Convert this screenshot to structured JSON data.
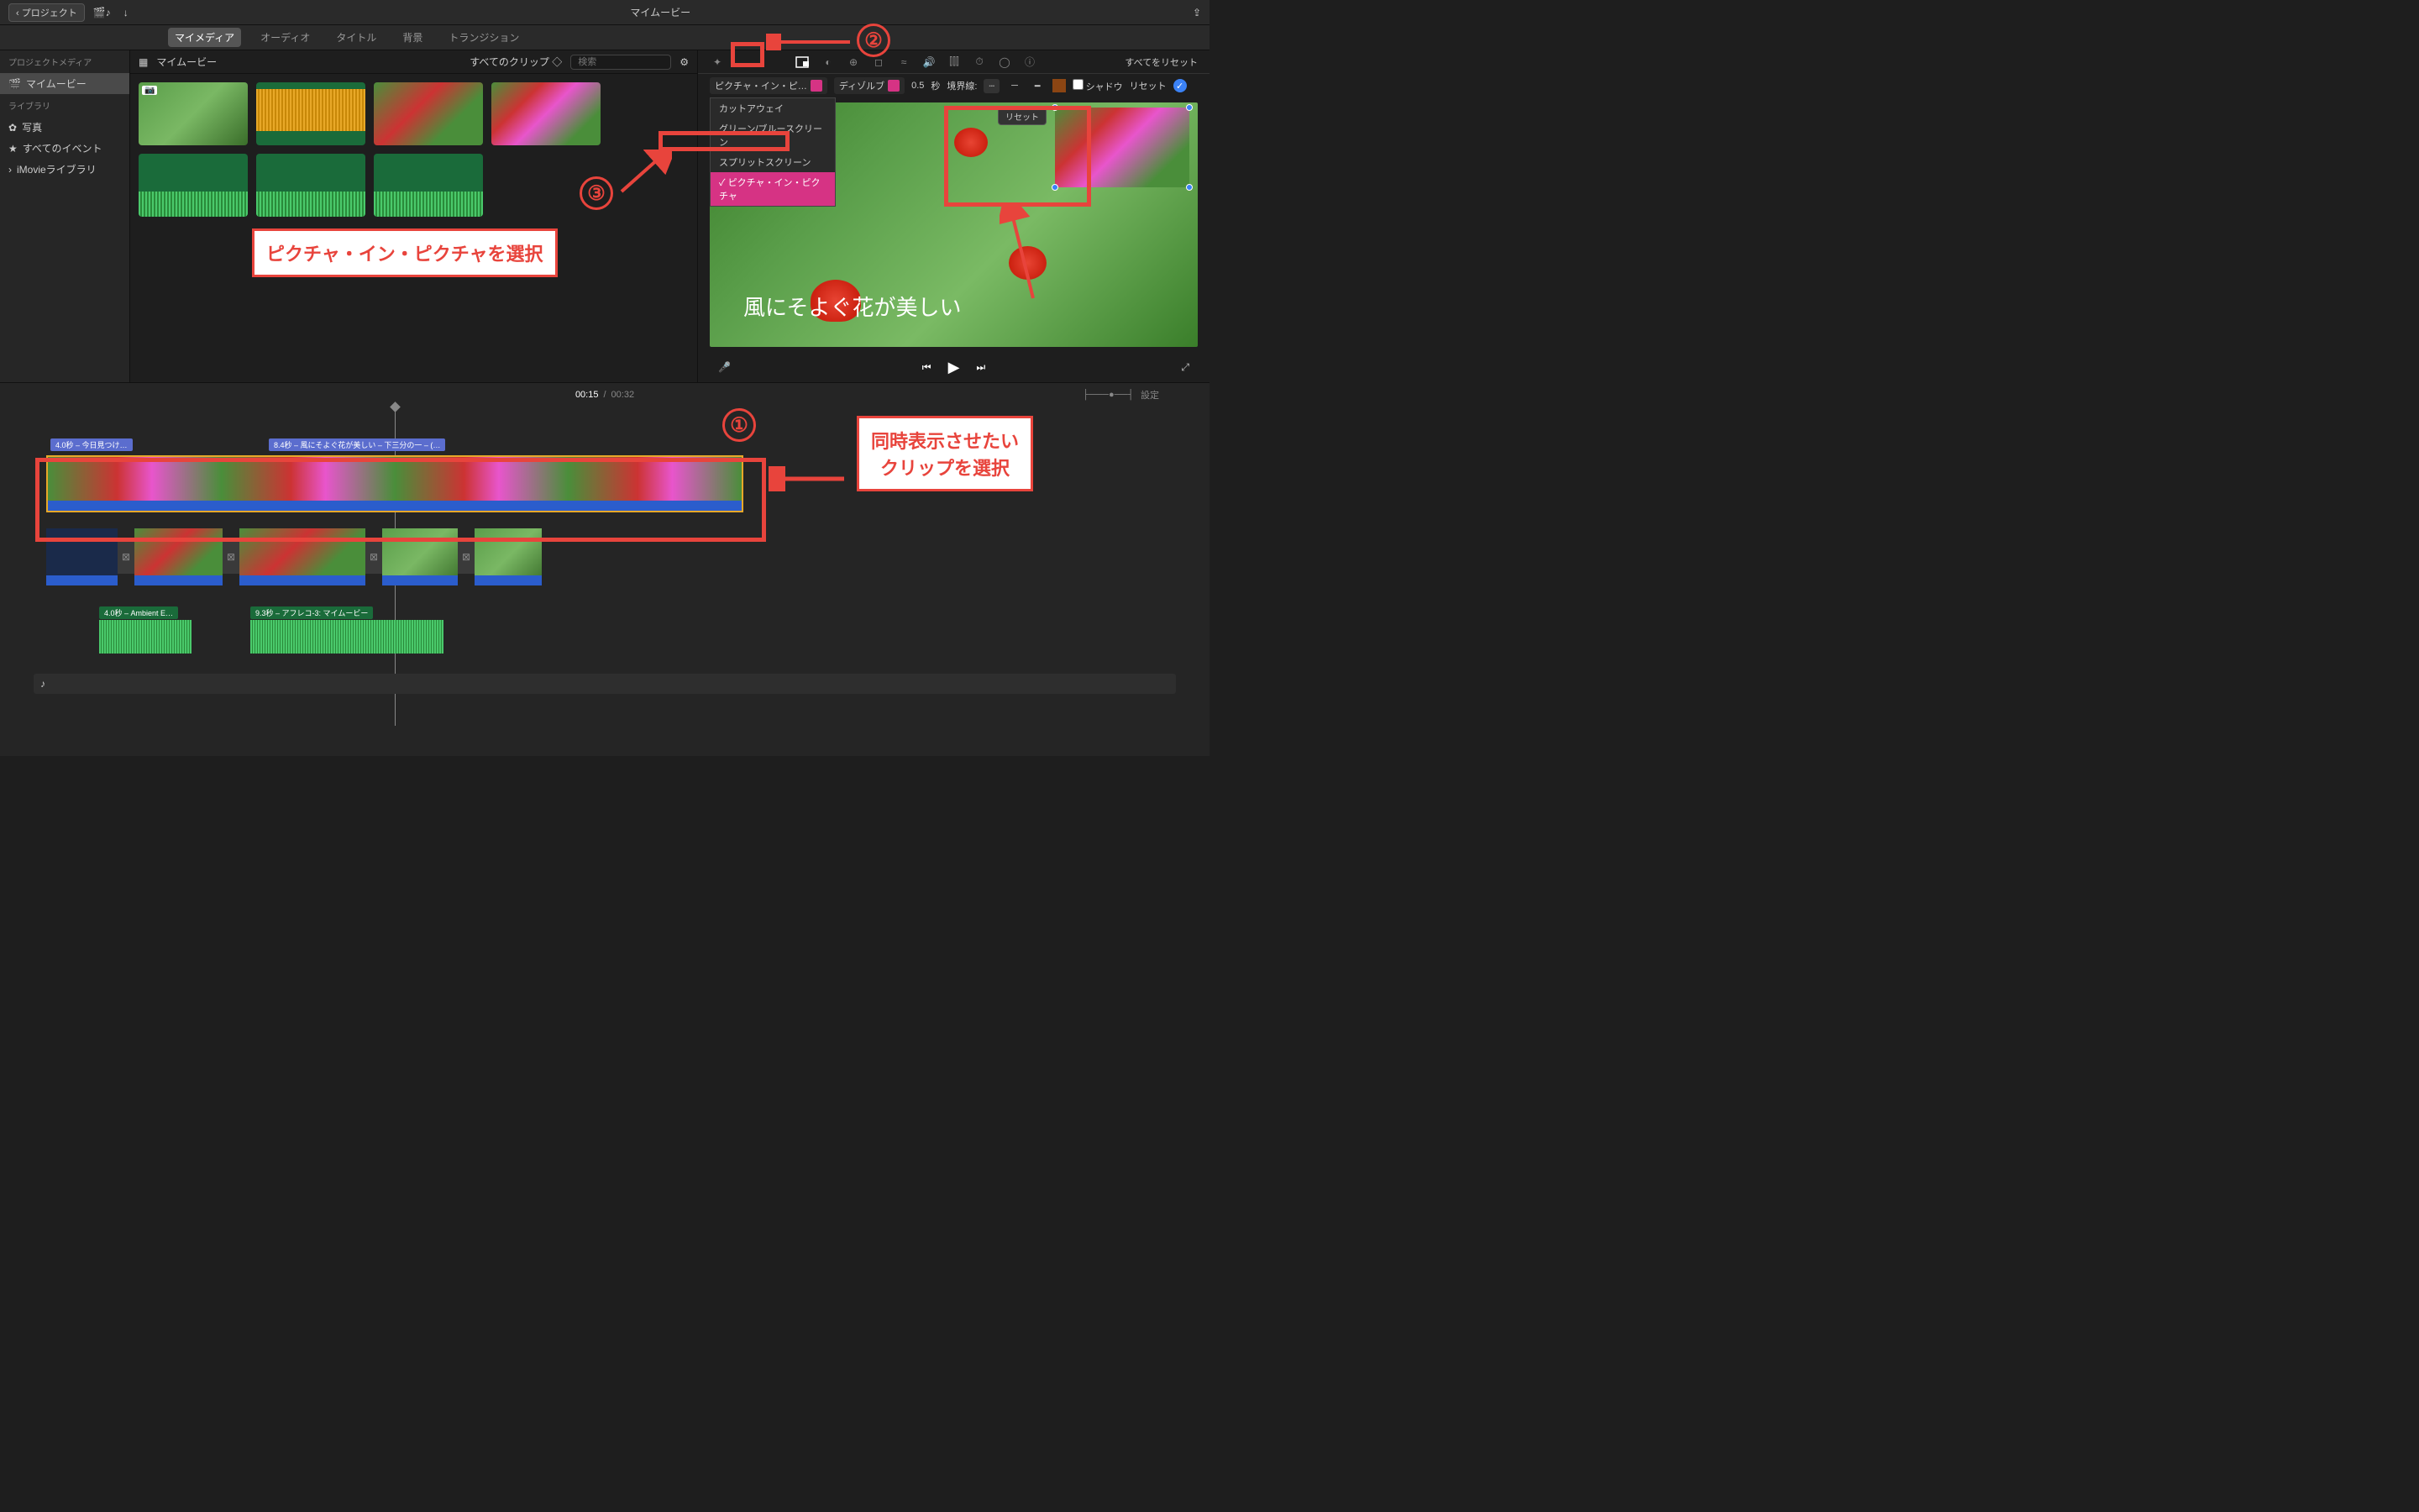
{
  "topbar": {
    "back": "プロジェクト",
    "title": "マイムービー"
  },
  "tabs": {
    "mymedia": "マイメディア",
    "audio": "オーディオ",
    "titles": "タイトル",
    "backgrounds": "背景",
    "transitions": "トランジション",
    "reset_all": "すべてをリセット"
  },
  "sidebar": {
    "hdr_project": "プロジェクトメディア",
    "movie": "マイムービー",
    "hdr_library": "ライブラリ",
    "photos": "写真",
    "all_events": "すべてのイベント",
    "imovie_lib": "iMovieライブラリ"
  },
  "browser": {
    "title": "マイムービー",
    "clips_filter": "すべてのクリップ",
    "search_ph": "検索"
  },
  "inspector": {
    "overlay_type": "ピクチャ・イン・ピ…",
    "transition": "ディゾルブ",
    "duration": "0.5",
    "sec": "秒",
    "border_lbl": "境界線:",
    "shadow": "シャドウ",
    "reset": "リセット",
    "pip_reset": "リセット"
  },
  "menu": {
    "cutaway": "カットアウェイ",
    "greenscreen": "グリーン/ブルースクリーン",
    "splitscreen": "スプリットスクリーン",
    "pip": "ピクチャ・イン・ピクチャ"
  },
  "preview": {
    "caption": "風にそよぐ花が美しい"
  },
  "timeline": {
    "current": "00:15",
    "total": "00:32",
    "settings": "設定",
    "clip1_lbl": "4.0秒 – 今日見つけ…",
    "clip2_lbl": "8.4秒 – 風にそよぐ花が美しい – 下三分の一 –  (…",
    "audio1_lbl": "4.0秒 – Ambient E…",
    "audio2_lbl": "9.3秒 – アフレコ-3: マイムービー"
  },
  "annotations": {
    "n1": "①",
    "n2": "②",
    "n3": "③",
    "select_pip": "ピクチャ・イン・ピクチャを選択",
    "select_clip_l1": "同時表示させたい",
    "select_clip_l2": "クリップを選択"
  }
}
